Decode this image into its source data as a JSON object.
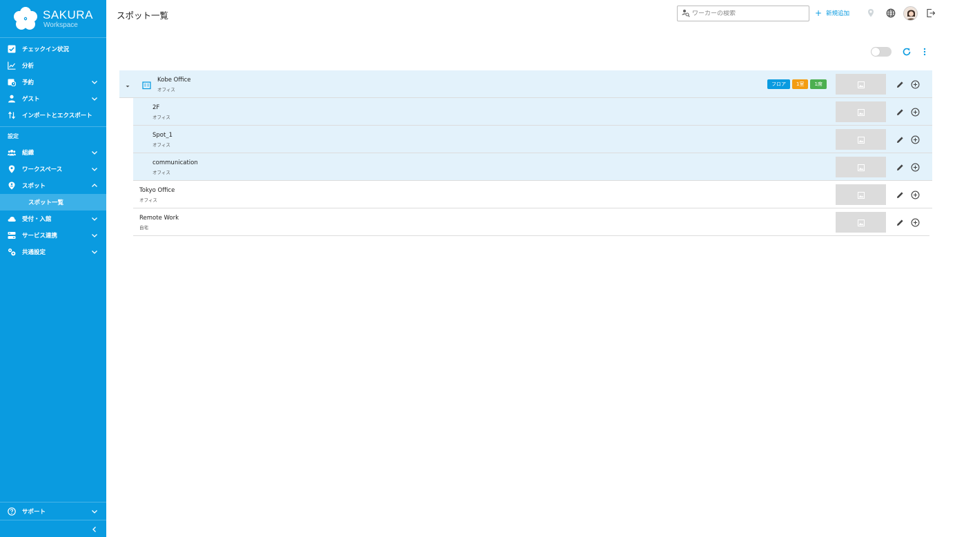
{
  "brand": {
    "name": "SAKURA",
    "sub": "Workspace"
  },
  "sidebar": {
    "items": [
      {
        "label": "チェックイン状況"
      },
      {
        "label": "分析"
      },
      {
        "label": "予約"
      },
      {
        "label": "ゲスト"
      },
      {
        "label": "インポートとエクスポート"
      }
    ],
    "section_label": "設定",
    "settings_items": [
      {
        "label": "組織"
      },
      {
        "label": "ワークスペース"
      },
      {
        "label": "スポット"
      }
    ],
    "active_sub_item": "スポット一覧",
    "settings_items_2": [
      {
        "label": "受付・入館"
      },
      {
        "label": "サービス連携"
      },
      {
        "label": "共通設定"
      }
    ],
    "support_label": "サポート"
  },
  "header": {
    "title": "スポット一覧",
    "search_placeholder": "ワーカーの検索",
    "add_label": "新規追加"
  },
  "list": {
    "rows": [
      {
        "name": "Kobe Office",
        "type": "オフィス"
      },
      {
        "name": "2F",
        "type": "オフィス"
      },
      {
        "name": "Spot_1",
        "type": "オフィス"
      },
      {
        "name": "communication",
        "type": "オフィス"
      },
      {
        "name": "Tokyo Office",
        "type": "オフィス"
      },
      {
        "name": "Remote Work",
        "type": "自宅"
      }
    ],
    "badges": [
      {
        "label": "フロア",
        "color": "#0a9be0"
      },
      {
        "label": "1室",
        "color": "#f39c12"
      },
      {
        "label": "1席",
        "color": "#4caf50"
      }
    ]
  },
  "colors": {
    "accent": "#0a9be0",
    "sidebar_active": "#3cb1e8",
    "row_highlight": "#e3f2fb"
  }
}
